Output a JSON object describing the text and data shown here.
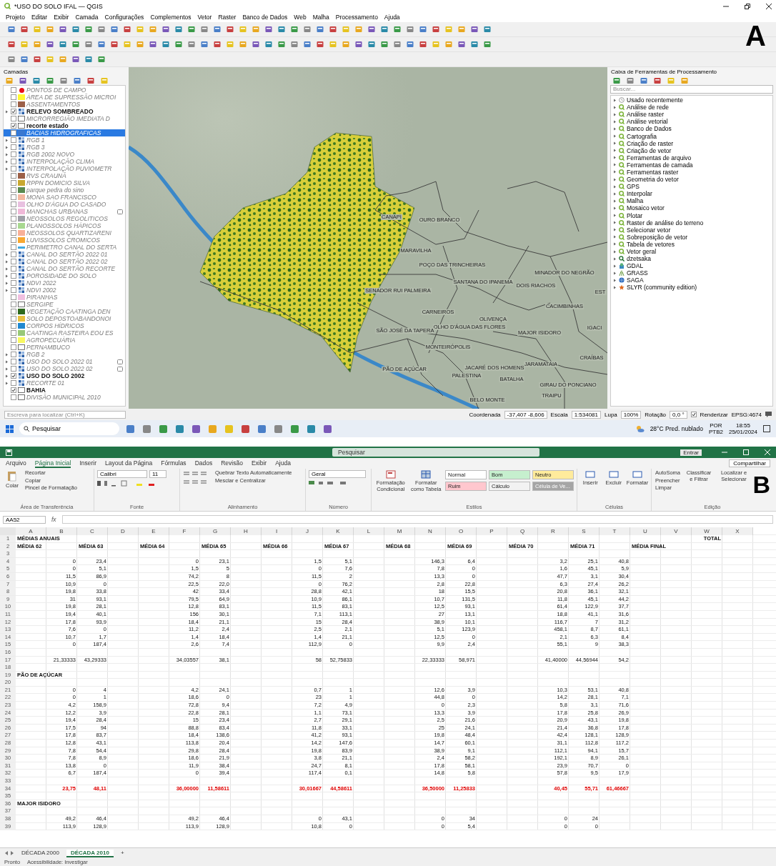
{
  "qgis": {
    "title": "*USO DO SOLO IFAL — QGIS",
    "panel_label": "A",
    "menu": [
      "Projeto",
      "Editar",
      "Exibir",
      "Camada",
      "Configurações",
      "Complementos",
      "Vetor",
      "Raster",
      "Banco de Dados",
      "Web",
      "Malha",
      "Processamento",
      "Ajuda"
    ],
    "layers_panel": {
      "title": "Camadas",
      "items": [
        {
          "label": "PONTOS DE CAMPO",
          "checked": false,
          "expandable": false,
          "kind": "point",
          "color": "#e8101a",
          "selected": false,
          "indicator": false
        },
        {
          "label": "ÁREA DE SUPRESSÃO MICROI",
          "checked": false,
          "expandable": false,
          "kind": "fill",
          "color": "#fff830",
          "selected": false,
          "indicator": false
        },
        {
          "label": "ASSENTAMENTOS",
          "checked": false,
          "expandable": false,
          "kind": "fill",
          "color": "#9c6048",
          "selected": false,
          "indicator": false
        },
        {
          "label": "RELEVO SOMBREADO",
          "checked": true,
          "expandable": true,
          "kind": "raster",
          "selected": false,
          "indicator": false
        },
        {
          "label": "MICRORREGIÃO IMEDIATA D",
          "checked": false,
          "expandable": false,
          "kind": "outline",
          "selected": false,
          "indicator": false
        },
        {
          "label": "recorte estado",
          "checked": true,
          "expandable": false,
          "kind": "outline",
          "selected": false,
          "indicator": false
        },
        {
          "label": "BACIAS HIDROGRAFICAS",
          "checked": false,
          "expandable": false,
          "kind": "fill",
          "color": "#3a78d0",
          "selected": true,
          "indicator": false
        },
        {
          "label": "RGB 1",
          "checked": false,
          "expandable": true,
          "kind": "raster",
          "selected": false,
          "indicator": false
        },
        {
          "label": "RGB 3",
          "checked": false,
          "expandable": true,
          "kind": "raster",
          "selected": false,
          "indicator": false
        },
        {
          "label": "RGB 2002 NOVO",
          "checked": false,
          "expandable": true,
          "kind": "raster",
          "selected": false,
          "indicator": false
        },
        {
          "label": "INTERPOLAÇÃO CLIMA",
          "checked": false,
          "expandable": true,
          "kind": "raster",
          "selected": false,
          "indicator": false
        },
        {
          "label": "INTERPOLAÇÃO PUVIOMETR",
          "checked": false,
          "expandable": true,
          "kind": "raster",
          "selected": false,
          "indicator": false
        },
        {
          "label": "RVS CRAUNÃ",
          "checked": false,
          "expandable": false,
          "kind": "fill",
          "color": "#9c6048",
          "selected": false,
          "indicator": false
        },
        {
          "label": "RPPN DOMICIO SILVA",
          "checked": false,
          "expandable": false,
          "kind": "fill",
          "color": "#c8a830",
          "selected": false,
          "indicator": false
        },
        {
          "label": "parque pedra do sino",
          "checked": false,
          "expandable": false,
          "kind": "fill",
          "color": "#5a8a50",
          "selected": false,
          "indicator": false
        },
        {
          "label": "MONA SAO FRANCISCO",
          "checked": false,
          "expandable": false,
          "kind": "fill",
          "color": "#f4b8a0",
          "selected": false,
          "indicator": false
        },
        {
          "label": "OLHO D'ÁGUA DO CASADO",
          "checked": false,
          "expandable": false,
          "kind": "fill",
          "color": "#e8c0e0",
          "selected": false,
          "indicator": false
        },
        {
          "label": "MANCHAS URBANAS",
          "checked": false,
          "expandable": false,
          "kind": "fill",
          "color": "#f0b8d8",
          "selected": false,
          "indicator": true
        },
        {
          "label": "NEOSSOLOS REGOLITICOS",
          "checked": false,
          "expandable": false,
          "kind": "fill",
          "color": "#a0a0a8",
          "selected": false,
          "indicator": false
        },
        {
          "label": "PLANOSSOLOS HÁPICOS",
          "checked": false,
          "expandable": false,
          "kind": "fill",
          "color": "#a8d890",
          "selected": false,
          "indicator": false
        },
        {
          "label": "NEOSSOLOS QUARTIZARENI",
          "checked": false,
          "expandable": false,
          "kind": "fill",
          "color": "#f8b098",
          "selected": false,
          "indicator": false
        },
        {
          "label": "LUVISSOLOS CROMICOS",
          "checked": false,
          "expandable": false,
          "kind": "fill",
          "color": "#f8a830",
          "selected": false,
          "indicator": false
        },
        {
          "label": "PERIMETRO CANAL DO SERTA",
          "checked": false,
          "expandable": false,
          "kind": "line",
          "color": "#40a8e0",
          "selected": false,
          "indicator": false
        },
        {
          "label": "CANAL DO SERTÃO 2022 01",
          "checked": false,
          "expandable": true,
          "kind": "raster",
          "selected": false,
          "indicator": false
        },
        {
          "label": "CANAL DO SERTÃO 2022 02",
          "checked": false,
          "expandable": true,
          "kind": "raster",
          "selected": false,
          "indicator": false
        },
        {
          "label": "CANAL DO SERTÃO RECORTE",
          "checked": false,
          "expandable": true,
          "kind": "raster",
          "selected": false,
          "indicator": false
        },
        {
          "label": "POROSIDADE DO SOLO",
          "checked": false,
          "expandable": true,
          "kind": "raster",
          "selected": false,
          "indicator": false
        },
        {
          "label": "NDVI 2022",
          "checked": false,
          "expandable": true,
          "kind": "raster",
          "selected": false,
          "indicator": false
        },
        {
          "label": "NDVI 2002",
          "checked": false,
          "expandable": true,
          "kind": "raster",
          "selected": false,
          "indicator": false
        },
        {
          "label": "PIRANHAS",
          "checked": false,
          "expandable": false,
          "kind": "fill",
          "color": "#f0c0e0",
          "selected": false,
          "indicator": false
        },
        {
          "label": "SERGIPE",
          "checked": false,
          "expandable": false,
          "kind": "outline",
          "selected": false,
          "indicator": false
        },
        {
          "label": "VEGETAÇÃO CAATINGA DEN",
          "checked": false,
          "expandable": false,
          "kind": "fill",
          "color": "#2e6a1e",
          "selected": false,
          "indicator": false
        },
        {
          "label": "SOLO DEPOSTOABANDONOI",
          "checked": false,
          "expandable": false,
          "kind": "fill",
          "color": "#e8c040",
          "selected": false,
          "indicator": false
        },
        {
          "label": "CORPOS HÍDRICOS",
          "checked": false,
          "expandable": false,
          "kind": "fill",
          "color": "#2088d0",
          "selected": false,
          "indicator": false
        },
        {
          "label": "CAATINGA RASTEIRA EOU ES",
          "checked": false,
          "expandable": false,
          "kind": "fill",
          "color": "#98c878",
          "selected": false,
          "indicator": false
        },
        {
          "label": "AGROPECUÁRIA",
          "checked": false,
          "expandable": false,
          "kind": "fill",
          "color": "#f8f860",
          "selected": false,
          "indicator": false
        },
        {
          "label": "PERNAMBUCO",
          "checked": false,
          "expandable": false,
          "kind": "outline",
          "selected": false,
          "indicator": false
        },
        {
          "label": "RGB 2",
          "checked": false,
          "expandable": true,
          "kind": "raster",
          "selected": false,
          "indicator": false
        },
        {
          "label": "USO DO SOLO 2022 01",
          "checked": false,
          "expandable": true,
          "kind": "raster",
          "selected": false,
          "indicator": true
        },
        {
          "label": "USO DO SOLO 2022 02",
          "checked": false,
          "expandable": true,
          "kind": "raster",
          "selected": false,
          "indicator": true
        },
        {
          "label": "USO DO SOLO 2002",
          "checked": true,
          "expandable": true,
          "kind": "raster",
          "selected": false,
          "indicator": false
        },
        {
          "label": "RECORTE 01",
          "checked": false,
          "expandable": true,
          "kind": "raster",
          "selected": false,
          "indicator": false
        },
        {
          "label": "BAHIA",
          "checked": true,
          "expandable": false,
          "kind": "outline",
          "selected": false,
          "indicator": false
        },
        {
          "label": "DIVISÃO MUNICIPAL 2010",
          "checked": false,
          "expandable": false,
          "kind": "outline",
          "selected": false,
          "indicator": false
        }
      ]
    },
    "map": {
      "labels": [
        "CANAPI",
        "OURO BRANCO",
        "MARAVILHA",
        "POÇO DAS TRINCHEIRAS",
        "SANTANA DO IPANEMA",
        "SENADOR RUI PALMEIRA",
        "MINADOR DO NEGRÃO",
        "DOIS RIACHOS",
        "CACIMBINHAS",
        "CARNEIROS",
        "OLIVENÇA",
        "OLHO D'ÁGUA DAS FLORES",
        "SÃO JOSÉ DA TAPERA",
        "MAJOR ISIDORO",
        "IGACI",
        "MONTEIRÓPOLIS",
        "CRAÍBAS",
        "PÃO DE AÇÚCAR",
        "JACARÉ DOS HOMENS",
        "JARAMATAIA",
        "PALESTINA",
        "BATALHA",
        "GIRAU DO PONCIANO",
        "TRAIPU",
        "BELO MONTE",
        "EST"
      ]
    },
    "toolbox": {
      "title": "Caixa de Ferramentas de Processamento",
      "search": {
        "placeholder": "Buscar..."
      },
      "items": [
        {
          "label": "Usado recentemente",
          "kind": "history"
        },
        {
          "label": "Análise de rede",
          "kind": "qgis"
        },
        {
          "label": "Análise raster",
          "kind": "qgis"
        },
        {
          "label": "Análise vetorial",
          "kind": "qgis"
        },
        {
          "label": "Banco de Dados",
          "kind": "qgis"
        },
        {
          "label": "Cartografia",
          "kind": "qgis"
        },
        {
          "label": "Criação de raster",
          "kind": "qgis"
        },
        {
          "label": "Criação de vetor",
          "kind": "qgis"
        },
        {
          "label": "Ferramentas de arquivo",
          "kind": "qgis"
        },
        {
          "label": "Ferramentas de camada",
          "kind": "qgis"
        },
        {
          "label": "Ferramentas raster",
          "kind": "qgis"
        },
        {
          "label": "Geometria do vetor",
          "kind": "qgis"
        },
        {
          "label": "GPS",
          "kind": "qgis"
        },
        {
          "label": "Interpolar",
          "kind": "qgis"
        },
        {
          "label": "Malha",
          "kind": "qgis"
        },
        {
          "label": "Mosaico vetor",
          "kind": "qgis"
        },
        {
          "label": "Plotar",
          "kind": "qgis"
        },
        {
          "label": "Raster de análise do terreno",
          "kind": "qgis"
        },
        {
          "label": "Selecionar vetor",
          "kind": "qgis"
        },
        {
          "label": "Sobreposição de vetor",
          "kind": "qgis"
        },
        {
          "label": "Tabela de vetores",
          "kind": "qgis"
        },
        {
          "label": "Vetor geral",
          "kind": "qgis"
        },
        {
          "label": "dzetsaka",
          "kind": "magnifier"
        },
        {
          "label": "GDAL",
          "kind": "gdal"
        },
        {
          "label": "GRASS",
          "kind": "grass"
        },
        {
          "label": "SAGA",
          "kind": "saga"
        },
        {
          "label": "SLYR (community edition)",
          "kind": "slyr"
        }
      ]
    },
    "status": {
      "search_placeholder": "Escreva para localizar (Ctrl+K)",
      "coordinate_label": "Coordenada",
      "coordinate": "-37,407 -8,606",
      "scale_label": "Escala",
      "scale": "1:534081",
      "magnifier_label": "Lupa",
      "magnifier": "100%",
      "rotation_label": "Rotação",
      "rotation": "0,0 °",
      "render_label": "Renderizar",
      "render_checked": true,
      "crs": "EPSG:4674"
    }
  },
  "taskbar": {
    "search": "Pesquisar",
    "weather": "28°C Pred. nublado",
    "lang": "POR",
    "layout": "PTB2",
    "time": "18:55",
    "date": "25/01/2024"
  },
  "excel": {
    "panel_label": "B",
    "search": "Pesquisar",
    "signin": "Entrar",
    "share": "Compartilhar",
    "tabs": [
      {
        "label": "Arquivo",
        "selected": false
      },
      {
        "label": "Página Inicial",
        "selected": true
      },
      {
        "label": "Inserir",
        "selected": false
      },
      {
        "label": "Layout da Página",
        "selected": false
      },
      {
        "label": "Fórmulas",
        "selected": false
      },
      {
        "label": "Dados",
        "selected": false
      },
      {
        "label": "Revisão",
        "selected": false
      },
      {
        "label": "Exibir",
        "selected": false
      },
      {
        "label": "Ajuda",
        "selected": false
      }
    ],
    "clipboard": {
      "paste": "Colar",
      "cut": "Recortar",
      "copy": "Copiar",
      "painter": "Pincel de Formatação",
      "group": "Área de Transferência"
    },
    "font": {
      "name": "Calibri",
      "size": "11",
      "group": "Fonte"
    },
    "alignment": {
      "wrap": "Quebrar Texto Automaticamente",
      "merge": "Mesclar e Centralizar",
      "group": "Alinhamento"
    },
    "number": {
      "format": "Geral",
      "group": "Número"
    },
    "styles": {
      "conditional": "Formatação Condicional",
      "as_table": "Formatar como Tabela",
      "group": "Estilos",
      "items": [
        {
          "label": "Normal",
          "color": "#ffffff"
        },
        {
          "label": "Bom",
          "color": "#c6efce"
        },
        {
          "label": "Neutro",
          "color": "#ffeb9c"
        },
        {
          "label": "Ruim",
          "color": "#ffc7ce"
        },
        {
          "label": "Cálculo",
          "color": "#f2f2f2"
        },
        {
          "label": "Célula de Ve...",
          "color": "#a5a5a5"
        }
      ]
    },
    "cells_group": {
      "insert": "Inserir",
      "delete": "Excluir",
      "format": "Formatar",
      "group": "Células"
    },
    "editing": {
      "autosum": "AutoSoma",
      "fill": "Preencher",
      "clear": "Limpar",
      "sort": "Classificar e Filtrar",
      "find": "Localizar e Selecionar",
      "group": "Edição"
    },
    "name_box": "AA52",
    "fx": "fx",
    "columns": [
      "A",
      "B",
      "C",
      "D",
      "E",
      "F",
      "G",
      "H",
      "I",
      "J",
      "K",
      "L",
      "M",
      "N",
      "O",
      "P",
      "Q",
      "R",
      "S",
      "T",
      "U",
      "V",
      "W",
      "X"
    ],
    "rows": [
      {
        "n": "1",
        "label": "MÉDIAS ANUAIS",
        "total": "TOTAL"
      },
      {
        "n": "2",
        "headers": [
          "MÉDIA 62",
          "MÉDIA 63",
          "MÉDIA 64",
          "MÉDIA 65",
          "MÉDIA 66",
          "MÉDIA 67",
          "MÉDIA 68",
          "MÉDIA 69",
          "MÉDIA 70",
          "MÉDIA 71",
          "MÉDIA FINAL"
        ]
      },
      {
        "n": "3"
      },
      {
        "n": "4",
        "values": [
          "0",
          "23,4",
          "0",
          "23,1",
          "1,5",
          "5,1",
          "146,3",
          "6,4",
          "3,2",
          "25,1",
          "40,8"
        ]
      },
      {
        "n": "5",
        "values": [
          "0",
          "5,1",
          "1,5",
          "5",
          "0",
          "7,6",
          "7,8",
          "0",
          "1,6",
          "45,1",
          "5,9"
        ]
      },
      {
        "n": "6",
        "values": [
          "11,5",
          "86,9",
          "74,2",
          "8",
          "11,5",
          "2",
          "13,3",
          "0",
          "47,7",
          "3,1",
          "30,4"
        ]
      },
      {
        "n": "7",
        "values": [
          "10,9",
          "0",
          "22,5",
          "22,0",
          "0",
          "76,2",
          "2,8",
          "22,8",
          "6,3",
          "27,4",
          "26,2"
        ]
      },
      {
        "n": "8",
        "values": [
          "19,8",
          "33,8",
          "42",
          "33,4",
          "28,8",
          "42,1",
          "18",
          "15,5",
          "20,8",
          "36,1",
          "32,1"
        ]
      },
      {
        "n": "9",
        "values": [
          "31",
          "93,1",
          "79,5",
          "64,9",
          "10,9",
          "86,1",
          "10,7",
          "131,5",
          "11,8",
          "45,1",
          "44,2"
        ]
      },
      {
        "n": "10",
        "values": [
          "19,8",
          "28,1",
          "12,8",
          "83,1",
          "11,5",
          "83,1",
          "12,5",
          "93,1",
          "61,4",
          "122,9",
          "37,7"
        ]
      },
      {
        "n": "11",
        "values": [
          "19,4",
          "40,1",
          "156",
          "30,1",
          "7,1",
          "113,1",
          "27",
          "13,1",
          "18,8",
          "41,1",
          "31,6"
        ]
      },
      {
        "n": "12",
        "values": [
          "17,8",
          "93,9",
          "18,4",
          "21,1",
          "15",
          "28,4",
          "38,9",
          "10,1",
          "116,7",
          "7",
          "31,2"
        ]
      },
      {
        "n": "13",
        "values": [
          "7,6",
          "0",
          "11,2",
          "2,4",
          "2,5",
          "2,1",
          "5,1",
          "123,9",
          "458,1",
          "8,7",
          "61,1"
        ]
      },
      {
        "n": "14",
        "values": [
          "10,7",
          "1,7",
          "1,4",
          "18,4",
          "1,4",
          "21,1",
          "12,5",
          "0",
          "2,1",
          "6,3",
          "8,4"
        ]
      },
      {
        "n": "15",
        "values": [
          "0",
          "187,4",
          "2,6",
          "7,4",
          "112,9",
          "0",
          "9,9",
          "2,4",
          "55,1",
          "9",
          "38,3"
        ]
      },
      {
        "n": "16"
      },
      {
        "n": "17",
        "values": [
          "21,33333",
          "43,29333",
          "34,03557",
          "38,1",
          "58",
          "52,75833",
          "22,33333",
          "58,971",
          "41,40000",
          "44,56944",
          "54,2"
        ]
      },
      {
        "n": "18"
      },
      {
        "n": "19",
        "label": "PÃO DE AÇÚCAR"
      },
      {
        "n": "20"
      },
      {
        "n": "21",
        "values": [
          "0",
          "4",
          "4,2",
          "24,1",
          "0,7",
          "1",
          "12,6",
          "3,9",
          "10,3",
          "53,1",
          "40,8"
        ]
      },
      {
        "n": "22",
        "values": [
          "0",
          "1",
          "18,6",
          "0",
          "23",
          "1",
          "44,8",
          "0",
          "14,2",
          "28,1",
          "7,1"
        ]
      },
      {
        "n": "23",
        "values": [
          "4,2",
          "158,9",
          "72,8",
          "9,4",
          "7,2",
          "4,9",
          "0",
          "2,3",
          "5,8",
          "3,1",
          "71,6"
        ]
      },
      {
        "n": "24",
        "values": [
          "12,2",
          "3,9",
          "22,8",
          "28,1",
          "1,1",
          "73,1",
          "13,3",
          "3,9",
          "17,8",
          "25,8",
          "26,9"
        ]
      },
      {
        "n": "25",
        "values": [
          "19,4",
          "28,4",
          "15",
          "23,4",
          "2,7",
          "29,1",
          "2,5",
          "21,6",
          "20,9",
          "43,1",
          "19,8"
        ]
      },
      {
        "n": "26",
        "values": [
          "17,5",
          "94",
          "88,8",
          "83,4",
          "11,8",
          "33,1",
          "25",
          "24,1",
          "21,4",
          "36,8",
          "17,8"
        ]
      },
      {
        "n": "27",
        "values": [
          "17,8",
          "83,7",
          "18,4",
          "138,6",
          "41,2",
          "93,1",
          "19,8",
          "48,4",
          "42,4",
          "128,1",
          "128,9"
        ]
      },
      {
        "n": "28",
        "values": [
          "12,8",
          "43,1",
          "113,8",
          "20,4",
          "14,2",
          "147,6",
          "14,7",
          "60,1",
          "31,1",
          "112,8",
          "117,2"
        ]
      },
      {
        "n": "29",
        "values": [
          "7,8",
          "54,4",
          "29,8",
          "28,4",
          "19,8",
          "83,9",
          "38,9",
          "9,1",
          "112,1",
          "94,1",
          "15,7"
        ]
      },
      {
        "n": "30",
        "values": [
          "7,8",
          "8,9",
          "18,6",
          "21,9",
          "3,8",
          "21,1",
          "2,4",
          "58,2",
          "192,1",
          "8,9",
          "26,1"
        ]
      },
      {
        "n": "31",
        "values": [
          "13,8",
          "0",
          "11,9",
          "38,4",
          "24,7",
          "8,1",
          "17,8",
          "58,1",
          "23,9",
          "70,7",
          "0"
        ]
      },
      {
        "n": "32",
        "values": [
          "6,7",
          "187,4",
          "0",
          "39,4",
          "117,4",
          "0,1",
          "14,8",
          "5,8",
          "57,8",
          "9,5",
          "17,9"
        ]
      },
      {
        "n": "33"
      },
      {
        "n": "34",
        "values": [
          "23,75",
          "48,11",
          "36,00000",
          "11,58611",
          "30,01667",
          "44,58611",
          "36,50000",
          "11,25833",
          "40,45",
          "55,71",
          "61,46667"
        ],
        "color": "#e00000"
      },
      {
        "n": "35"
      },
      {
        "n": "36",
        "label": "MAJOR ISIDORO"
      },
      {
        "n": "37"
      },
      {
        "n": "38",
        "values": [
          "49,2",
          "46,4",
          "49,2",
          "46,4",
          "0",
          "43,1",
          "0",
          "34",
          "0",
          "24"
        ]
      },
      {
        "n": "39",
        "values": [
          "113,9",
          "128,9",
          "113,9",
          "128,9",
          "10,8",
          "0",
          "0",
          "5,4",
          "0",
          "0"
        ]
      }
    ],
    "sheets": [
      {
        "label": "DÉCADA 2000",
        "selected": false
      },
      {
        "label": "DÉCADA 2010",
        "selected": true
      }
    ],
    "add_sheet": "+",
    "status": "Pronto",
    "accessibility": "Acessibilidade: Investigar"
  }
}
